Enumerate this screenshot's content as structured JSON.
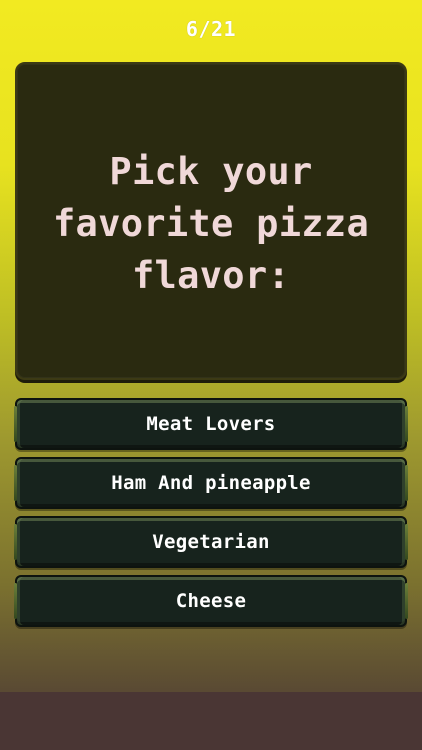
{
  "progress": {
    "counter": "6/21",
    "current": 6,
    "total": 21
  },
  "question": {
    "text": "Pick your favorite pizza flavor:"
  },
  "answers": [
    {
      "label": "Meat Lovers"
    },
    {
      "label": "Ham And pineapple"
    },
    {
      "label": "Vegetarian"
    },
    {
      "label": "Cheese"
    }
  ],
  "colors": {
    "background_top": "#f2ea21",
    "background_bottom": "#4a3a32",
    "card_background": "#2a2a10",
    "question_text": "#f0d8d8",
    "button_background": "#17231d",
    "button_text": "#ffffff",
    "bottom_bar": "#4a3634"
  }
}
